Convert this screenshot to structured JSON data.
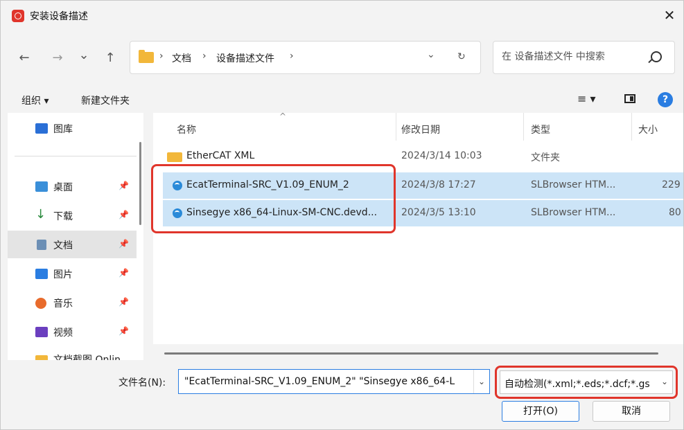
{
  "window": {
    "title": "安装设备描述",
    "close": "✕"
  },
  "nav": {
    "back": "←",
    "forward": "→",
    "recent": "⌄",
    "up": "↑",
    "breadcrumb": [
      "文档",
      "设备描述文件"
    ],
    "crumb_sep": "›",
    "dropdown": "⌄",
    "refresh": "↻",
    "search_placeholder": "在 设备描述文件 中搜索"
  },
  "toolbar": {
    "organize": "组织 ▾",
    "new_folder": "新建文件夹",
    "view": "≡ ▾",
    "help": "?"
  },
  "sidebar": {
    "items": [
      {
        "label": "图库",
        "icon": "gallery-icon",
        "color": "#2a6fd6",
        "pinned": ""
      },
      {
        "label": "桌面",
        "icon": "desktop-icon",
        "color": "#3a8fd9",
        "pinned": "📌"
      },
      {
        "label": "下载",
        "icon": "download-icon",
        "color": "#2b8a3e",
        "pinned": "📌"
      },
      {
        "label": "文档",
        "icon": "documents-icon",
        "color": "#6c8fb5",
        "pinned": "📌"
      },
      {
        "label": "图片",
        "icon": "pictures-icon",
        "color": "#2a7de1",
        "pinned": "📌"
      },
      {
        "label": "音乐",
        "icon": "music-icon",
        "color": "#e86b2c",
        "pinned": "📌"
      },
      {
        "label": "视频",
        "icon": "videos-icon",
        "color": "#6b3fbf",
        "pinned": "📌"
      },
      {
        "label": "文档截图 Onlin",
        "icon": "folder-icon",
        "color": "#f2b73a",
        "pinned": ""
      }
    ]
  },
  "files": {
    "columns": {
      "name": "名称",
      "modified": "修改日期",
      "type": "类型",
      "size": "大小"
    },
    "sort_caret": "^",
    "rows": [
      {
        "name": "EtherCAT XML",
        "modified": "2024/3/14 10:03",
        "type": "文件夹",
        "size": "",
        "icon": "folder-icon"
      },
      {
        "name": "EcatTerminal-SRC_V1.09_ENUM_2",
        "modified": "2024/3/8 17:27",
        "type": "SLBrowser HTM...",
        "size": "229",
        "icon": "browser-file-icon"
      },
      {
        "name": "Sinsegye x86_64-Linux-SM-CNC.devd...",
        "modified": "2024/3/5 13:10",
        "type": "SLBrowser HTM...",
        "size": "80",
        "icon": "browser-file-icon"
      }
    ]
  },
  "footer": {
    "filename_label": "文件名(N):",
    "filename_value": "\"EcatTerminal-SRC_V1.09_ENUM_2\" \"Sinsegye x86_64-L",
    "filter_value": "自动检测(*.xml;*.eds;*.dcf;*.gs",
    "caret": "⌄",
    "open_label": "打开(O)",
    "cancel_label": "取消"
  },
  "colors": {
    "accent": "#2a7de1",
    "highlight": "#e0352b",
    "selected_row": "#cce4f7"
  }
}
